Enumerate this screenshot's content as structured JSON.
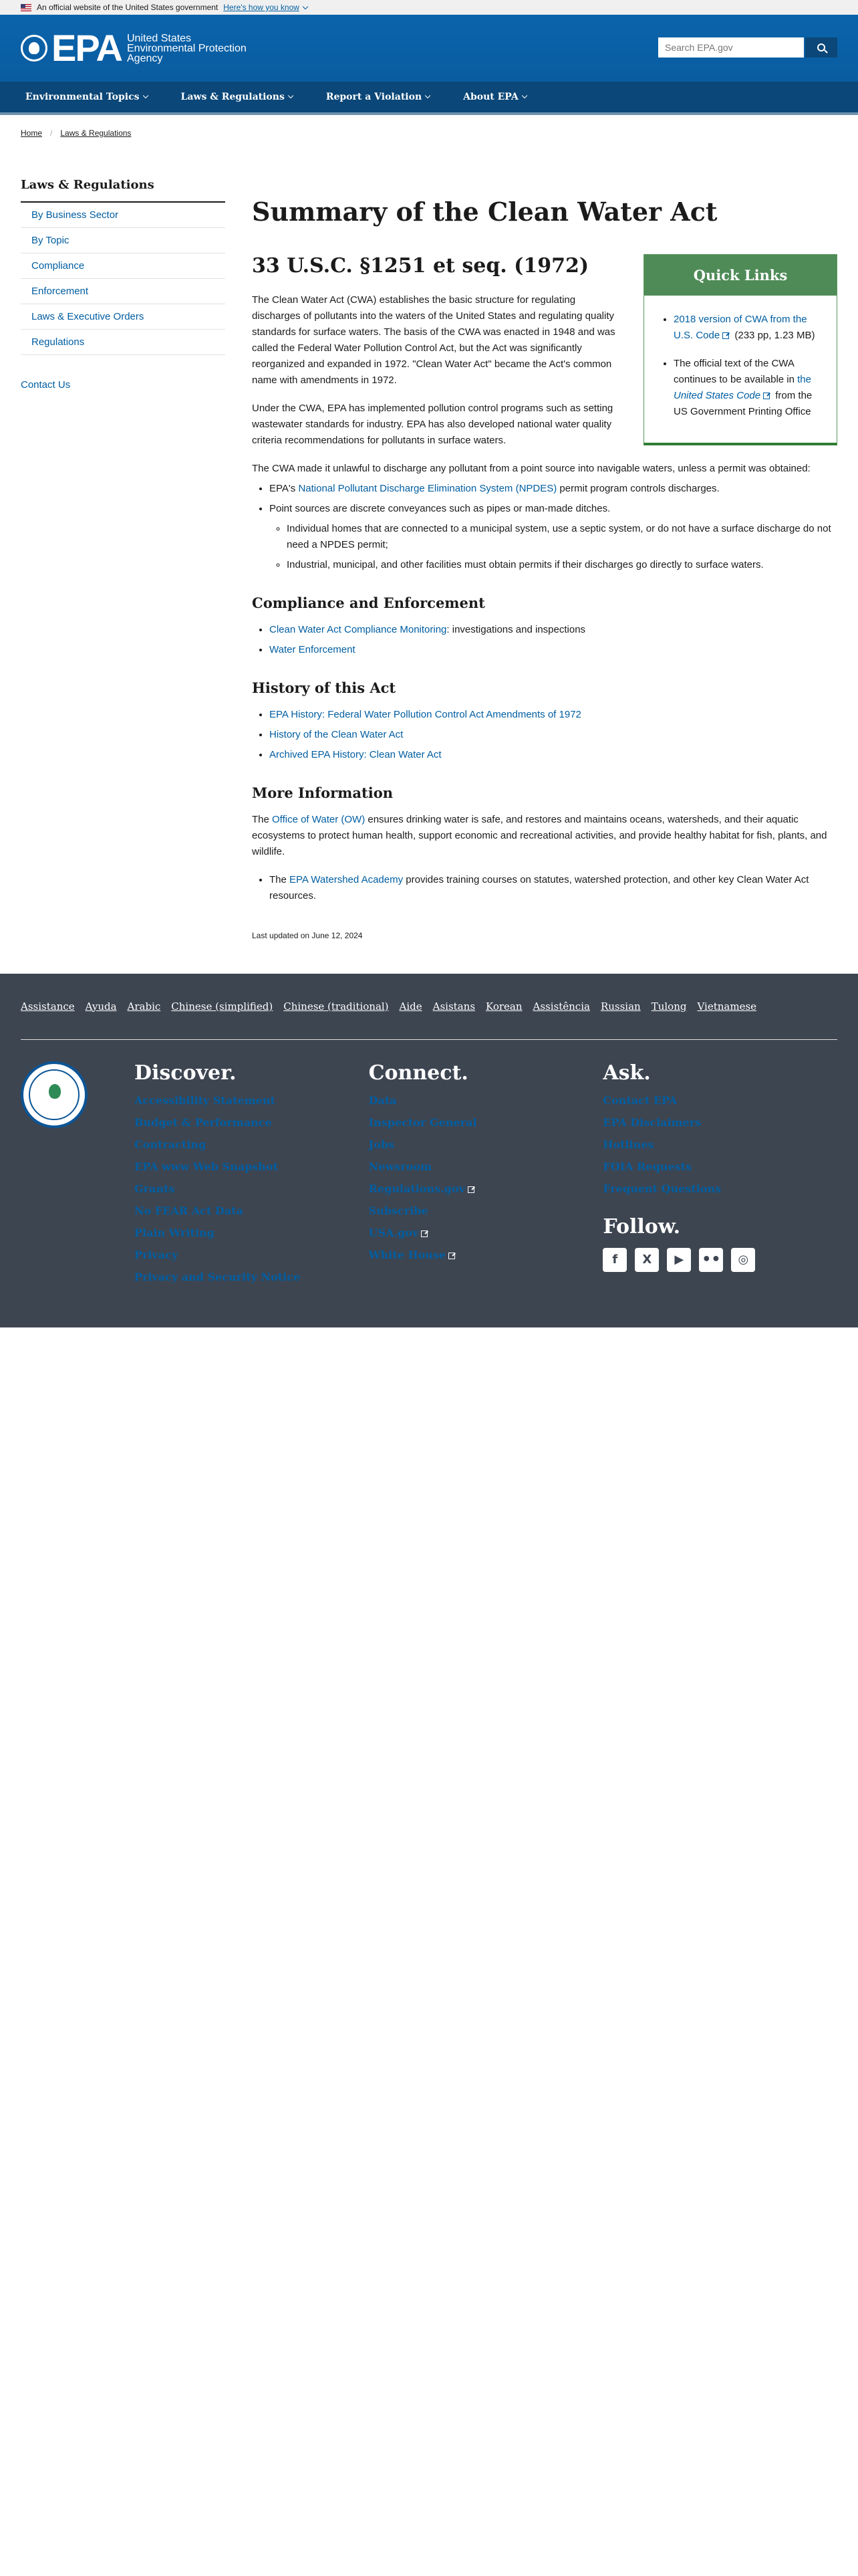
{
  "banner": {
    "text": "An official website of the United States government",
    "how": "Here's how you know"
  },
  "header": {
    "logo_letters": "EPA",
    "logo_line1": "United States",
    "logo_line2": "Environmental Protection",
    "logo_line3": "Agency",
    "search_placeholder": "Search EPA.gov"
  },
  "nav": [
    "Environmental Topics",
    "Laws & Regulations",
    "Report a Violation",
    "About EPA"
  ],
  "breadcrumb": [
    "Home",
    "Laws & Regulations"
  ],
  "sidebar": {
    "title": "Laws & Regulations",
    "items": [
      "By Business Sector",
      "By Topic",
      "Compliance",
      "Enforcement",
      "Laws & Executive Orders",
      "Regulations"
    ],
    "contact": "Contact Us"
  },
  "main": {
    "title": "Summary of the Clean Water Act",
    "subtitle": "33 U.S.C. §1251 et seq. (1972)",
    "p1": "The Clean Water Act (CWA) establishes the basic structure for regulating discharges of pollutants into the waters of the United States and regulating quality standards for surface waters. The basis of the CWA was enacted in 1948 and was called the Federal Water Pollution Control Act, but the Act was significantly reorganized and expanded in 1972. \"Clean Water Act\" became the Act's common name with amendments in 1972.",
    "p2": "Under the CWA, EPA has implemented pollution control programs such as setting wastewater standards for industry. EPA has also developed national water quality criteria recommendations for pollutants in surface waters.",
    "p3": "The CWA made it unlawful to discharge any pollutant from a point source into navigable waters, unless a permit was obtained:",
    "b1_pre": "EPA's ",
    "b1_link": "National Pollutant Discharge Elimination System (NPDES)",
    "b1_post": " permit program controls discharges.",
    "b2": "Point sources are discrete conveyances such as pipes or man-made ditches.",
    "b2a": "Individual homes that are connected to a municipal system, use a septic system, or do not have a surface discharge do not need a NPDES permit;",
    "b2b": "Industrial, municipal, and other facilities must obtain permits if their discharges go directly to surface waters.",
    "h_compliance": "Compliance and Enforcement",
    "c1_link": "Clean Water Act Compliance Monitoring",
    "c1_post": ": investigations and inspections",
    "c2_link": "Water Enforcement",
    "h_history": "History of this Act",
    "hist1": "EPA History: Federal Water Pollution Control Act Amendments of 1972",
    "hist2": "History of the Clean Water Act",
    "hist3": "Archived EPA History: Clean Water Act",
    "h_more": "More Information",
    "m1_pre": "The ",
    "m1_link": "Office of Water (OW)",
    "m1_post": " ensures drinking water is safe, and restores and maintains oceans, watersheds, and their aquatic ecosystems to protect human health, support economic and recreational activities, and provide healthy habitat for fish, plants, and wildlife.",
    "m2_pre": "The ",
    "m2_link": "EPA Watershed Academy",
    "m2_post": " provides training courses on statutes, watershed protection, and other key Clean Water Act resources.",
    "updated": "Last updated on June 12, 2024"
  },
  "quick_links": {
    "title": "Quick Links",
    "q1_link": "2018 version of CWA from the U.S. Code",
    "q1_post": "(233 pp, 1.23 MB)",
    "q2_pre": "The official text of the CWA continues to be available in ",
    "q2_link1": "the ",
    "q2_link_italic": "United States Code",
    "q2_post": " from the US Government Printing Office"
  },
  "footer": {
    "languages": [
      "Assistance",
      "Ayuda",
      "Arabic",
      "Chinese (simplified)",
      "Chinese (traditional)",
      "Aide",
      "Asistans",
      "Korean",
      "Assistência",
      "Russian",
      "Tulong",
      "Vietnamese"
    ],
    "discover_title": "Discover.",
    "discover": [
      "Accessibility Statement",
      "Budget & Performance",
      "Contracting",
      "EPA www Web Snapshot",
      "Grants",
      "No FEAR Act Data",
      "Plain Writing",
      "Privacy",
      "Privacy and Security Notice"
    ],
    "connect_title": "Connect.",
    "connect": [
      "Data",
      "Inspector General",
      "Jobs",
      "Newsroom",
      "Regulations.gov",
      "Subscribe",
      "USA.gov",
      "White House"
    ],
    "ask_title": "Ask.",
    "ask": [
      "Contact EPA",
      "EPA Disclaimers",
      "Hotlines",
      "FOIA Requests",
      "Frequent Questions"
    ],
    "follow_title": "Follow.",
    "social": [
      "facebook-icon",
      "x-icon",
      "youtube-icon",
      "flickr-icon",
      "instagram-icon"
    ]
  }
}
